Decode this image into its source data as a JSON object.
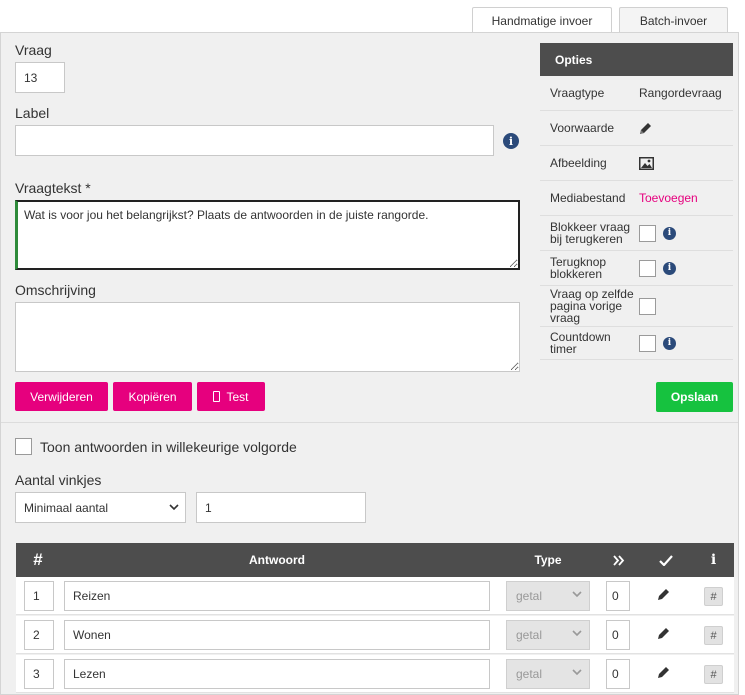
{
  "tabs": [
    {
      "label": "Handmatige invoer",
      "active": true
    },
    {
      "label": "Batch-invoer",
      "active": false
    }
  ],
  "form": {
    "question_label": "Vraag",
    "question_value": "13",
    "label_label": "Label",
    "label_value": "",
    "text_label": "Vraagtekst *",
    "text_value": "Wat is voor jou het belangrijkst? Plaats de antwoorden in de juiste rangorde.",
    "description_label": "Omschrijving",
    "description_value": ""
  },
  "actions": {
    "delete": "Verwijderen",
    "copy": "Kopiëren",
    "test": "Test",
    "save": "Opslaan"
  },
  "options": {
    "title": "Opties",
    "rows": [
      {
        "key": "Vraagtype",
        "value": "Rangordevraag"
      },
      {
        "key": "Voorwaarde",
        "icon": "pencil-icon"
      },
      {
        "key": "Afbeelding",
        "icon": "image-icon"
      },
      {
        "key": "Mediabestand",
        "value": "Toevoegen"
      },
      {
        "key": "Blokkeer vraag bij terugkeren",
        "checked": false
      },
      {
        "key": "Terugknop blokkeren",
        "checked": false
      },
      {
        "key": "Vraag op zelfde pagina vorige vraag",
        "checked": false
      },
      {
        "key": "Countdown timer",
        "checked": false
      }
    ]
  },
  "settings": {
    "random_order_label": "Toon antwoorden in willekeurige volgorde",
    "random_order_checked": false,
    "count_label": "Aantal vinkjes",
    "count_mode": "Minimaal aantal",
    "count_value": "1"
  },
  "table": {
    "headers": {
      "num": "#",
      "answer": "Antwoord",
      "type": "Type"
    },
    "header_icons": [
      "double-chevron-right-icon",
      "checkmark-icon",
      "info-icon"
    ],
    "rows": [
      {
        "num": "1",
        "answer": "Reizen",
        "type": "getal",
        "value": "0"
      },
      {
        "num": "2",
        "answer": "Wonen",
        "type": "getal",
        "value": "0"
      },
      {
        "num": "3",
        "answer": "Lezen",
        "type": "getal",
        "value": "0"
      }
    ],
    "row_hash": "#"
  },
  "colors": {
    "accent": "#e6007e",
    "save": "#16c23f",
    "header": "#4d4d4d",
    "info": "#2b4a7a"
  }
}
